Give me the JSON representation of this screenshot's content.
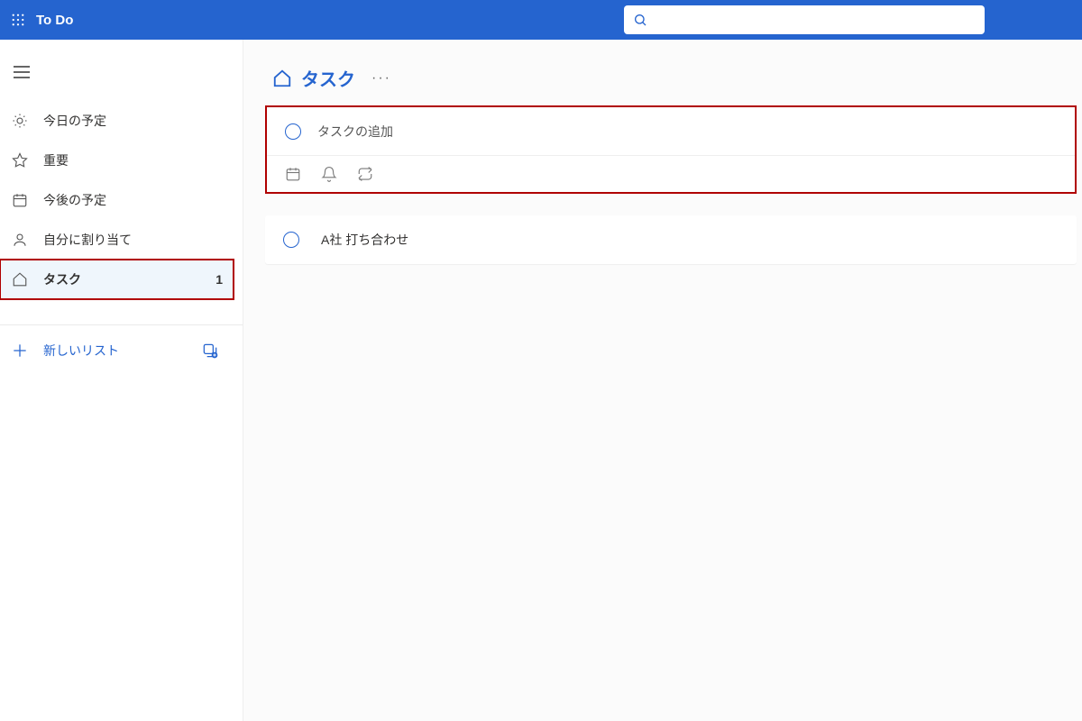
{
  "header": {
    "app_title": "To Do",
    "search_placeholder": ""
  },
  "sidebar": {
    "items": [
      {
        "label": "今日の予定",
        "icon": "sun"
      },
      {
        "label": "重要",
        "icon": "star"
      },
      {
        "label": "今後の予定",
        "icon": "calendar"
      },
      {
        "label": "自分に割り当て",
        "icon": "person"
      },
      {
        "label": "タスク",
        "icon": "home",
        "count": "1",
        "active": true,
        "highlighted": true
      }
    ],
    "new_list_label": "新しいリスト"
  },
  "main": {
    "title": "タスク",
    "add_task_placeholder": "タスクの追加",
    "tasks": [
      {
        "title": "A社  打ち合わせ"
      }
    ]
  }
}
